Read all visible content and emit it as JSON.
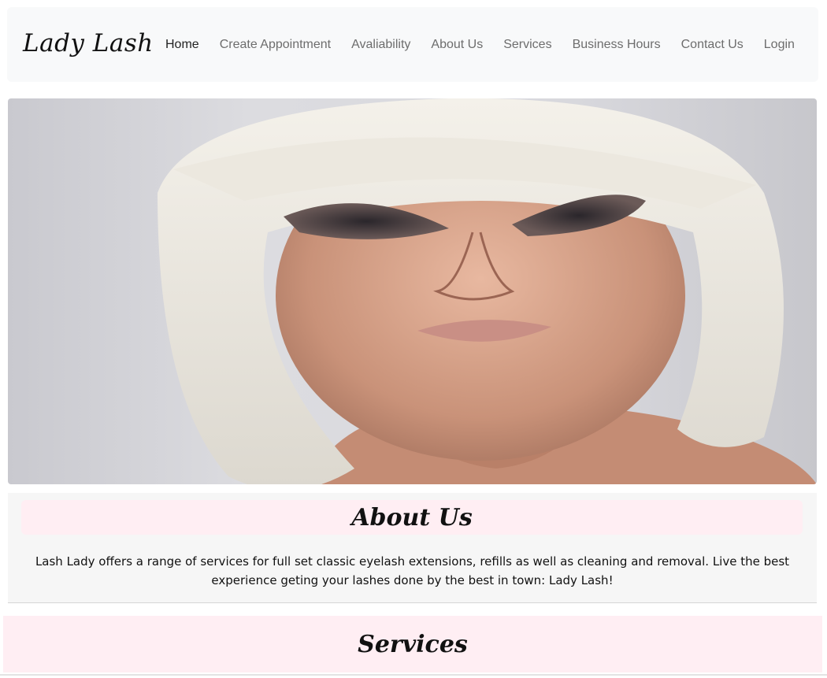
{
  "brand": {
    "name": "Lady Lash"
  },
  "nav": {
    "items": [
      {
        "label": "Home",
        "active": true
      },
      {
        "label": "Create Appointment",
        "active": false
      },
      {
        "label": "Avaliability",
        "active": false
      },
      {
        "label": "About Us",
        "active": false
      },
      {
        "label": "Services",
        "active": false
      },
      {
        "label": "Business Hours",
        "active": false
      },
      {
        "label": "Contact Us",
        "active": false
      },
      {
        "label": "Login",
        "active": false
      }
    ]
  },
  "about": {
    "title": "About Us",
    "text": "Lash Lady offers a range of services for full set classic eyelash extensions, refills as well as cleaning and removal. Live the best experience geting your lashes done by the best in town: Lady Lash!"
  },
  "services": {
    "title": "Services"
  },
  "colors": {
    "navbar_bg": "#f8f9fa",
    "section_pink": "#ffeef3",
    "about_bg": "#f6f6f6"
  }
}
